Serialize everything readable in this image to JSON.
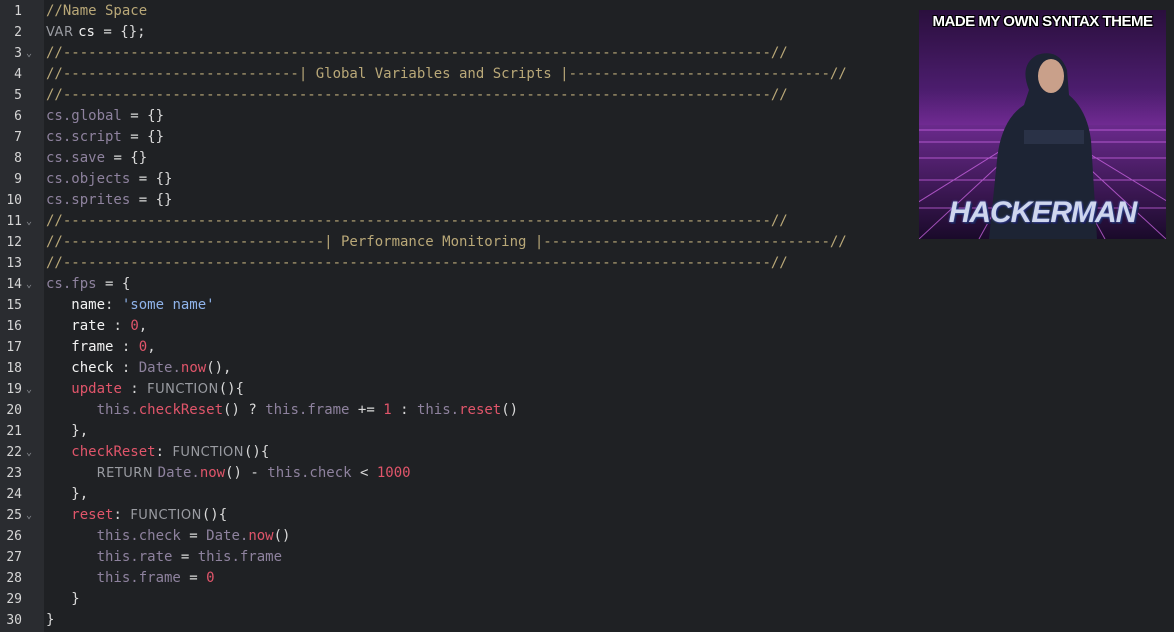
{
  "editor": {
    "lines": [
      {
        "n": "1",
        "fold": "",
        "segs": [
          {
            "c": "t-comment",
            "t": "//Name Space"
          }
        ]
      },
      {
        "n": "2",
        "fold": "",
        "segs": [
          {
            "c": "t-kw",
            "t": "VAR "
          },
          {
            "c": "t-ident",
            "t": "cs"
          },
          {
            "c": "t-plain",
            "t": " = {};"
          }
        ]
      },
      {
        "n": "3",
        "fold": "⌄",
        "segs": [
          {
            "c": "t-comment",
            "t": "//------------------------------------------------------------------------------------//"
          }
        ]
      },
      {
        "n": "4",
        "fold": "",
        "segs": [
          {
            "c": "t-comment",
            "t": "//----------------------------| Global Variables and Scripts |-------------------------------//"
          }
        ]
      },
      {
        "n": "5",
        "fold": "",
        "segs": [
          {
            "c": "t-comment",
            "t": "//------------------------------------------------------------------------------------//"
          }
        ]
      },
      {
        "n": "6",
        "fold": "",
        "segs": [
          {
            "c": "t-obj",
            "t": "cs.global"
          },
          {
            "c": "t-plain",
            "t": " = {}"
          }
        ]
      },
      {
        "n": "7",
        "fold": "",
        "segs": [
          {
            "c": "t-obj",
            "t": "cs.script"
          },
          {
            "c": "t-plain",
            "t": " = {}"
          }
        ]
      },
      {
        "n": "8",
        "fold": "",
        "segs": [
          {
            "c": "t-obj",
            "t": "cs.save"
          },
          {
            "c": "t-plain",
            "t": " = {}"
          }
        ]
      },
      {
        "n": "9",
        "fold": "",
        "segs": [
          {
            "c": "t-obj",
            "t": "cs.objects"
          },
          {
            "c": "t-plain",
            "t": " = {}"
          }
        ]
      },
      {
        "n": "10",
        "fold": "",
        "segs": [
          {
            "c": "t-obj",
            "t": "cs.sprites"
          },
          {
            "c": "t-plain",
            "t": " = {}"
          }
        ]
      },
      {
        "n": "11",
        "fold": "⌄",
        "segs": [
          {
            "c": "t-comment",
            "t": "//------------------------------------------------------------------------------------//"
          }
        ]
      },
      {
        "n": "12",
        "fold": "",
        "segs": [
          {
            "c": "t-comment",
            "t": "//-------------------------------| Performance Monitoring |----------------------------------//"
          }
        ]
      },
      {
        "n": "13",
        "fold": "",
        "segs": [
          {
            "c": "t-comment",
            "t": "//------------------------------------------------------------------------------------//"
          }
        ]
      },
      {
        "n": "14",
        "fold": "⌄",
        "segs": [
          {
            "c": "t-obj",
            "t": "cs.fps"
          },
          {
            "c": "t-plain",
            "t": " = {"
          }
        ]
      },
      {
        "n": "15",
        "fold": "",
        "segs": [
          {
            "c": "t-plain",
            "t": "   "
          },
          {
            "c": "t-key",
            "t": "name"
          },
          {
            "c": "t-plain",
            "t": ": "
          },
          {
            "c": "t-str",
            "t": "'some name'"
          }
        ]
      },
      {
        "n": "16",
        "fold": "",
        "segs": [
          {
            "c": "t-plain",
            "t": "   "
          },
          {
            "c": "t-key",
            "t": "rate"
          },
          {
            "c": "t-plain",
            "t": " : "
          },
          {
            "c": "t-num",
            "t": "0"
          },
          {
            "c": "t-plain",
            "t": ","
          }
        ]
      },
      {
        "n": "17",
        "fold": "",
        "segs": [
          {
            "c": "t-plain",
            "t": "   "
          },
          {
            "c": "t-key",
            "t": "frame"
          },
          {
            "c": "t-plain",
            "t": " : "
          },
          {
            "c": "t-num",
            "t": "0"
          },
          {
            "c": "t-plain",
            "t": ","
          }
        ]
      },
      {
        "n": "18",
        "fold": "",
        "segs": [
          {
            "c": "t-plain",
            "t": "   "
          },
          {
            "c": "t-key",
            "t": "check"
          },
          {
            "c": "t-plain",
            "t": " : "
          },
          {
            "c": "t-obj",
            "t": "Date."
          },
          {
            "c": "t-method",
            "t": "now"
          },
          {
            "c": "t-plain",
            "t": "(),"
          }
        ]
      },
      {
        "n": "19",
        "fold": "⌄",
        "segs": [
          {
            "c": "t-plain",
            "t": "   "
          },
          {
            "c": "t-ukey",
            "t": "update"
          },
          {
            "c": "t-plain",
            "t": " : "
          },
          {
            "c": "t-kw",
            "t": "FUNCTION"
          },
          {
            "c": "t-plain",
            "t": "(){"
          }
        ]
      },
      {
        "n": "20",
        "fold": "",
        "segs": [
          {
            "c": "t-plain",
            "t": "      "
          },
          {
            "c": "t-this",
            "t": "this."
          },
          {
            "c": "t-method",
            "t": "checkReset"
          },
          {
            "c": "t-plain",
            "t": "() ? "
          },
          {
            "c": "t-this",
            "t": "this.frame"
          },
          {
            "c": "t-plain",
            "t": " += "
          },
          {
            "c": "t-num",
            "t": "1"
          },
          {
            "c": "t-plain",
            "t": " : "
          },
          {
            "c": "t-this",
            "t": "this."
          },
          {
            "c": "t-method",
            "t": "reset"
          },
          {
            "c": "t-plain",
            "t": "()"
          }
        ]
      },
      {
        "n": "21",
        "fold": "",
        "segs": [
          {
            "c": "t-plain",
            "t": "   },"
          }
        ]
      },
      {
        "n": "22",
        "fold": "⌄",
        "segs": [
          {
            "c": "t-plain",
            "t": "   "
          },
          {
            "c": "t-ukey",
            "t": "checkReset"
          },
          {
            "c": "t-plain",
            "t": ": "
          },
          {
            "c": "t-kw",
            "t": "FUNCTION"
          },
          {
            "c": "t-plain",
            "t": "(){"
          }
        ]
      },
      {
        "n": "23",
        "fold": "",
        "segs": [
          {
            "c": "t-plain",
            "t": "      "
          },
          {
            "c": "t-kw",
            "t": "RETURN "
          },
          {
            "c": "t-obj",
            "t": "Date."
          },
          {
            "c": "t-method",
            "t": "now"
          },
          {
            "c": "t-plain",
            "t": "() - "
          },
          {
            "c": "t-this",
            "t": "this.check"
          },
          {
            "c": "t-plain",
            "t": " < "
          },
          {
            "c": "t-num",
            "t": "1000"
          }
        ]
      },
      {
        "n": "24",
        "fold": "",
        "segs": [
          {
            "c": "t-plain",
            "t": "   },"
          }
        ]
      },
      {
        "n": "25",
        "fold": "⌄",
        "segs": [
          {
            "c": "t-plain",
            "t": "   "
          },
          {
            "c": "t-ukey",
            "t": "reset"
          },
          {
            "c": "t-plain",
            "t": ": "
          },
          {
            "c": "t-kw",
            "t": "FUNCTION"
          },
          {
            "c": "t-plain",
            "t": "(){"
          }
        ]
      },
      {
        "n": "26",
        "fold": "",
        "segs": [
          {
            "c": "t-plain",
            "t": "      "
          },
          {
            "c": "t-this",
            "t": "this.check"
          },
          {
            "c": "t-plain",
            "t": " = "
          },
          {
            "c": "t-obj",
            "t": "Date."
          },
          {
            "c": "t-method",
            "t": "now"
          },
          {
            "c": "t-plain",
            "t": "()"
          }
        ]
      },
      {
        "n": "27",
        "fold": "",
        "segs": [
          {
            "c": "t-plain",
            "t": "      "
          },
          {
            "c": "t-this",
            "t": "this.rate"
          },
          {
            "c": "t-plain",
            "t": " = "
          },
          {
            "c": "t-this",
            "t": "this.frame"
          }
        ]
      },
      {
        "n": "28",
        "fold": "",
        "segs": [
          {
            "c": "t-plain",
            "t": "      "
          },
          {
            "c": "t-this",
            "t": "this.frame"
          },
          {
            "c": "t-plain",
            "t": " = "
          },
          {
            "c": "t-num",
            "t": "0"
          }
        ]
      },
      {
        "n": "29",
        "fold": "",
        "segs": [
          {
            "c": "t-plain",
            "t": "   }"
          }
        ]
      },
      {
        "n": "30",
        "fold": "",
        "segs": [
          {
            "c": "t-plain",
            "t": "}"
          }
        ]
      }
    ]
  },
  "meme": {
    "caption": "MADE MY OWN SYNTAX THEME",
    "title": "HACKERMAN"
  },
  "colors": {
    "background": "#1f2124",
    "gutter": "#2a2c30",
    "comment": "#b9a878",
    "accent_red": "#e0556a",
    "string_blue": "#8fb3ea",
    "object_purple": "#8e829e"
  }
}
